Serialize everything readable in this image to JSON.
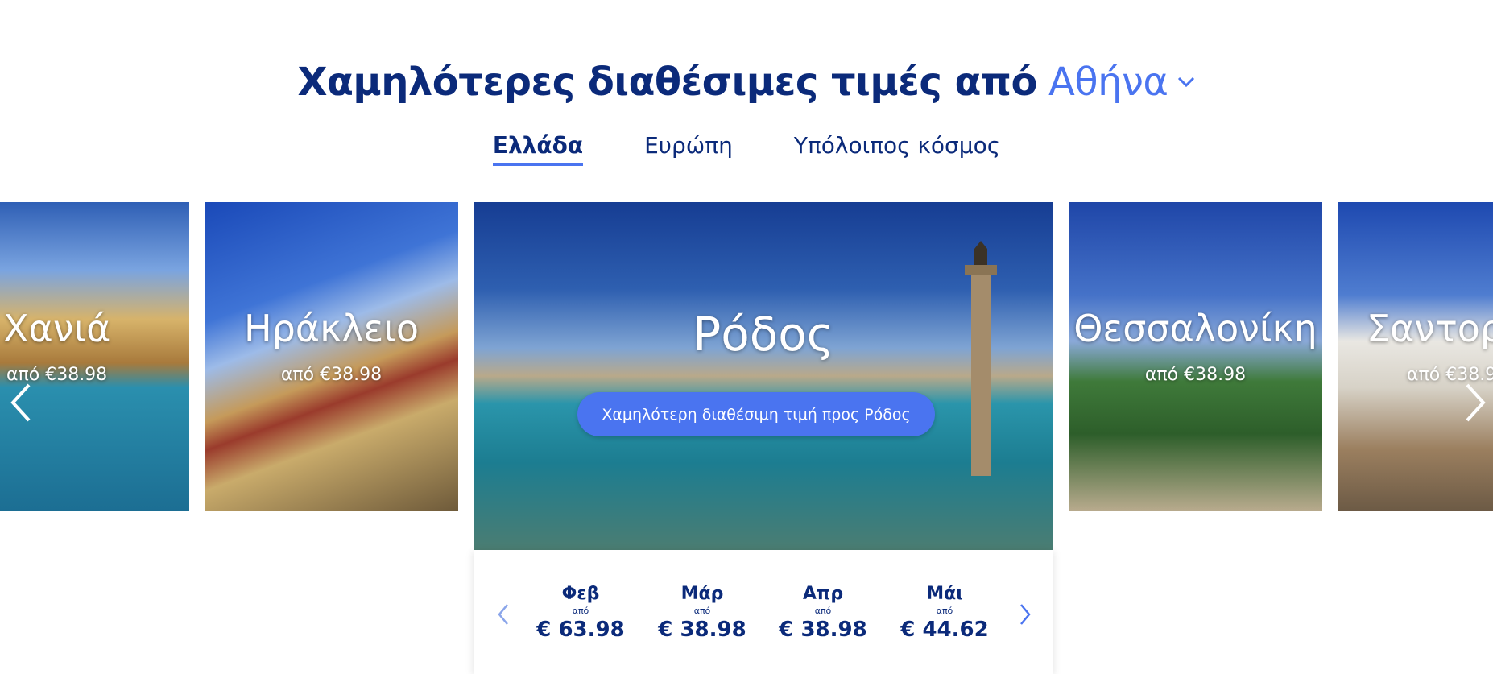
{
  "header": {
    "title": "Χαμηλότερες διαθέσιμες τιμές από",
    "origin_city": "Αθήνα"
  },
  "tabs": [
    {
      "label": "Ελλάδα",
      "active": true
    },
    {
      "label": "Ευρώπη",
      "active": false
    },
    {
      "label": "Υπόλοιπος κόσμος",
      "active": false
    }
  ],
  "destinations": [
    {
      "name": "Χανιά",
      "price": "από €38.98"
    },
    {
      "name": "Ηράκλειο",
      "price": "από €38.98"
    },
    {
      "name": "Θεσσαλονίκη",
      "price": "από €38.98"
    },
    {
      "name": "Σαντορ",
      "price": "από €38.9"
    }
  ],
  "featured": {
    "name": "Ρόδος",
    "cta_label": "Χαμηλότερη διαθέσιμη τιμή προς Ρόδος"
  },
  "months": [
    {
      "month": "Φεβ",
      "from": "από",
      "price": "€ 63.98"
    },
    {
      "month": "Μάρ",
      "from": "από",
      "price": "€ 38.98"
    },
    {
      "month": "Απρ",
      "from": "από",
      "price": "€ 38.98"
    },
    {
      "month": "Μάι",
      "from": "από",
      "price": "€ 44.62"
    }
  ],
  "colors": {
    "brand_navy": "#0b2a7a",
    "accent_blue": "#4a74f0"
  },
  "icons": {
    "dropdown": "chevron-down-icon",
    "prev": "chevron-left-icon",
    "next": "chevron-right-icon"
  }
}
